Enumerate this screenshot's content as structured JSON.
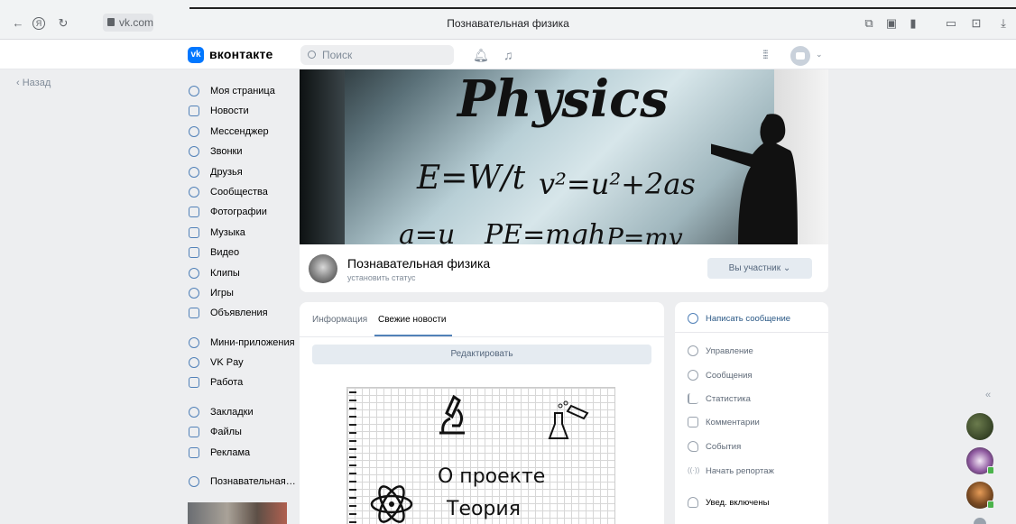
{
  "browser": {
    "url": "vk.com",
    "tab_title": "Познавательная физика"
  },
  "header": {
    "logo_text": "вконтакте",
    "search_placeholder": "Поиск"
  },
  "back_label": "Назад",
  "left_nav": {
    "group1": [
      "Моя страница",
      "Новости",
      "Мессенджер",
      "Звонки",
      "Друзья",
      "Сообщества",
      "Фотографии",
      "Музыка",
      "Видео",
      "Клипы",
      "Игры",
      "Объявления"
    ],
    "group2": [
      "Мини-приложения",
      "VK Pay",
      "Работа"
    ],
    "group3": [
      "Закладки",
      "Файлы",
      "Реклама"
    ],
    "group4": [
      "Познавательная ..."
    ]
  },
  "cover": {
    "chalk_title": "Physics",
    "formulas": [
      "E=W/t",
      "v²=u²+2as",
      "a=u",
      "PE=mgh",
      "P=mv"
    ]
  },
  "profile": {
    "name": "Познавательная физика",
    "status": "установить статус",
    "member_button": "Вы участник ⌄"
  },
  "main": {
    "tabs": [
      "Информация",
      "Свежие новости"
    ],
    "edit_button": "Редактировать",
    "post_lines": [
      "О проекте",
      "Теория"
    ]
  },
  "side": {
    "items": [
      "Написать сообщение",
      "Управление",
      "Сообщения",
      "Статистика",
      "Комментарии",
      "События",
      "Начать репортаж",
      "Увед. включены"
    ]
  },
  "colors": {
    "vk_blue": "#0077ff",
    "link_blue": "#2a5885",
    "page_bg": "#edeef0"
  }
}
